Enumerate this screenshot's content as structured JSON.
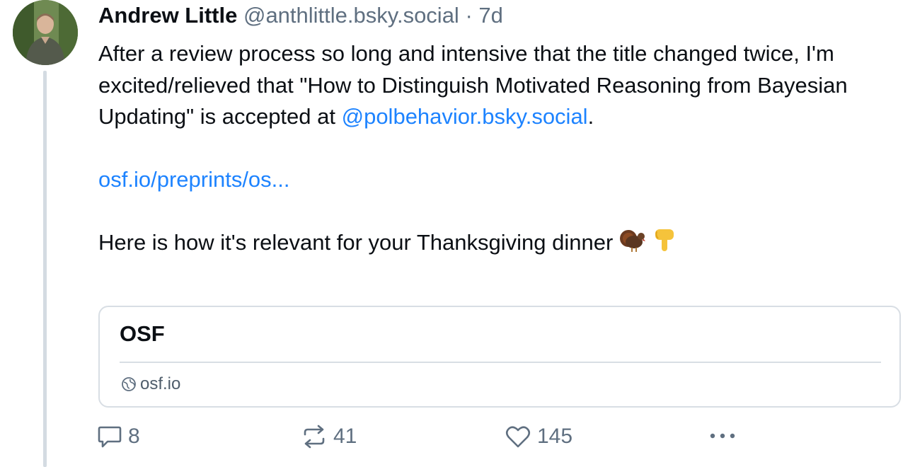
{
  "author": {
    "display_name": "Andrew Little",
    "handle": "@anthlittle.bsky.social",
    "separator": "·",
    "age": "7d",
    "avatar_icon": "user-avatar-photo"
  },
  "post": {
    "line1_text": "After a review process so long and intensive that the title changed twice, I'm excited/relieved that \"How to Distinguish Motivated Reasoning from Bayesian Updating\" is accepted at ",
    "mention": "@polbehavior.bsky.social",
    "line1_end": ".",
    "link": "osf.io/preprints/os...",
    "line3_text": "Here is how it's relevant for your Thanksgiving dinner",
    "emojis": [
      "turkey-emoji",
      "pointing-down-emoji"
    ]
  },
  "link_card": {
    "title": "OSF",
    "domain": "osf.io",
    "domain_icon": "globe-icon"
  },
  "actions": {
    "reply_count": "8",
    "repost_count": "41",
    "like_count": "145",
    "reply_icon": "reply-bubble-icon",
    "repost_icon": "repost-icon",
    "like_icon": "heart-icon",
    "more_icon": "more-dots-icon"
  },
  "colors": {
    "link": "#1d83ff",
    "muted": "#5f6f80",
    "border": "#d8dee4",
    "thread_line": "#d4dbe2"
  }
}
